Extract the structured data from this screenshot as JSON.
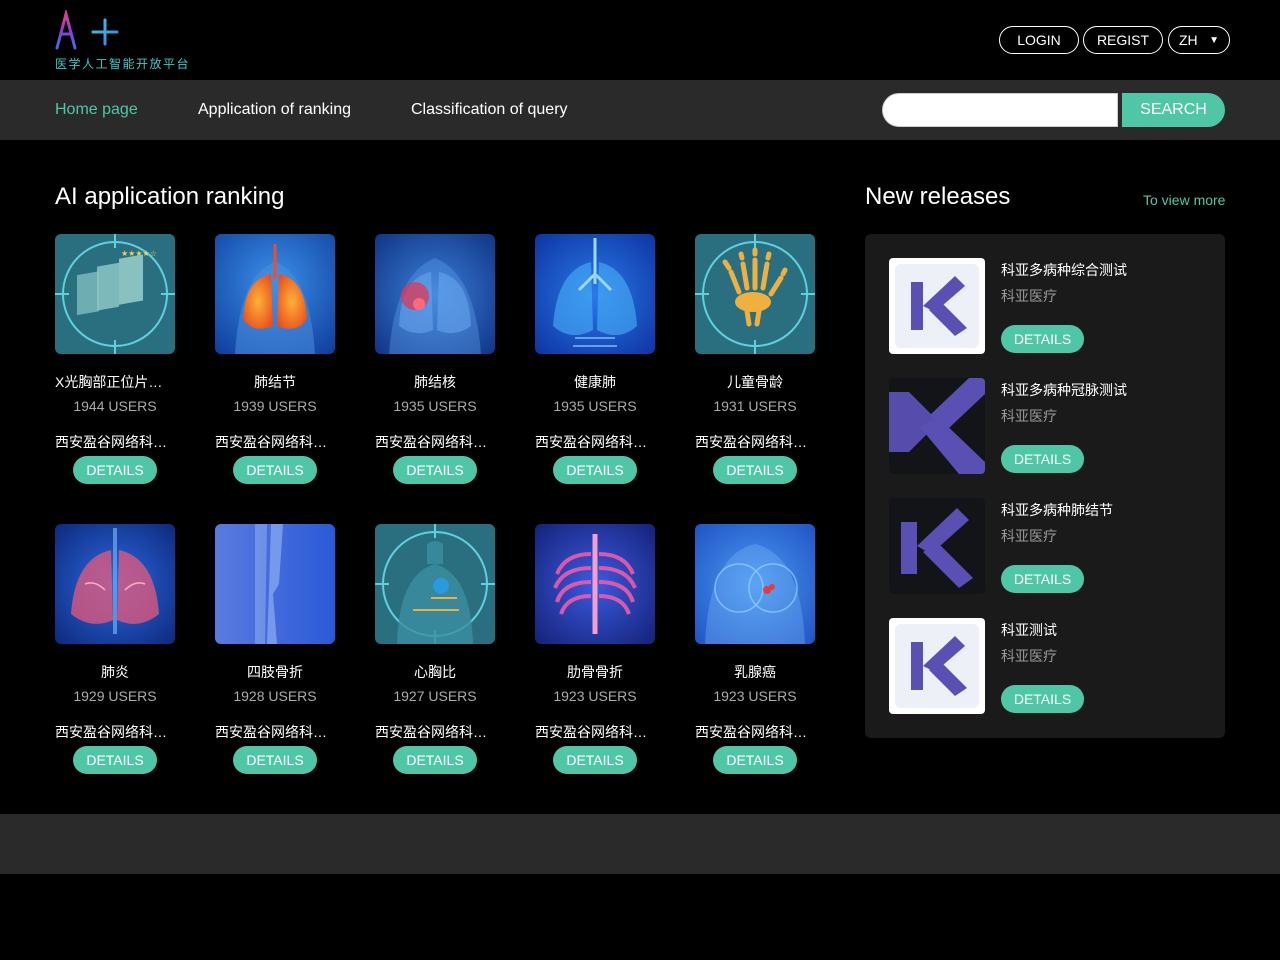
{
  "header": {
    "logo_text": "AI+",
    "logo_subtitle": "医学人工智能开放平台",
    "login_label": "LOGIN",
    "regist_label": "REGIST",
    "language": "ZH"
  },
  "nav": {
    "items": [
      {
        "label": "Home page",
        "active": true
      },
      {
        "label": "Application of ranking",
        "active": false
      },
      {
        "label": "Classification of query",
        "active": false
      }
    ],
    "search_placeholder": "",
    "search_label": "SEARCH"
  },
  "ranking": {
    "title": "AI application ranking",
    "details_label": "DETAILS",
    "items": [
      {
        "name": "X光胸部正位片质控",
        "users": "1944 USERS",
        "org": "西安盈谷网络科技有限公司",
        "icon": "chest-xray-film-icon"
      },
      {
        "name": "肺结节",
        "users": "1939 USERS",
        "org": "西安盈谷网络科技有限公司",
        "icon": "lung-nodule-icon"
      },
      {
        "name": "肺结核",
        "users": "1935 USERS",
        "org": "西安盈谷网络科技有限公司",
        "icon": "tuberculosis-lung-icon"
      },
      {
        "name": "健康肺",
        "users": "1935 USERS",
        "org": "西安盈谷网络科技有限公司",
        "icon": "healthy-lung-icon"
      },
      {
        "name": "儿童骨龄",
        "users": "1931 USERS",
        "org": "西安盈谷网络科技有限公司",
        "icon": "child-hand-bone-icon"
      },
      {
        "name": "肺炎",
        "users": "1929 USERS",
        "org": "西安盈谷网络科技有限公司",
        "icon": "pneumonia-lung-icon"
      },
      {
        "name": "四肢骨折",
        "users": "1928 USERS",
        "org": "西安盈谷网络科技有限公司",
        "icon": "limb-fracture-icon"
      },
      {
        "name": "心胸比",
        "users": "1927 USERS",
        "org": "西安盈谷网络科技有限公司",
        "icon": "cardiothoracic-ratio-icon"
      },
      {
        "name": "肋骨骨折",
        "users": "1923 USERS",
        "org": "西安盈谷网络科技有限公司",
        "icon": "rib-fracture-icon"
      },
      {
        "name": "乳腺癌",
        "users": "1923 USERS",
        "org": "西安盈谷网络科技有限公司",
        "icon": "breast-cancer-icon"
      }
    ]
  },
  "releases": {
    "title": "New releases",
    "view_more": "To view more",
    "details_label": "DETAILS",
    "items": [
      {
        "name": "科亚多病种综合测试",
        "org": "科亚医疗",
        "logo_theme": "light"
      },
      {
        "name": "科亚多病种冠脉测试",
        "org": "科亚医疗",
        "logo_theme": "dark"
      },
      {
        "name": "科亚多病种肺结节",
        "org": "科亚医疗",
        "logo_theme": "dark"
      },
      {
        "name": "科亚测试",
        "org": "科亚医疗",
        "logo_theme": "light"
      }
    ]
  },
  "colors": {
    "accent": "#4fc7a7",
    "nav_bg": "#2a2a2a",
    "panel_bg": "#1a1a1a",
    "logo_brand": "#5a4fb3"
  }
}
